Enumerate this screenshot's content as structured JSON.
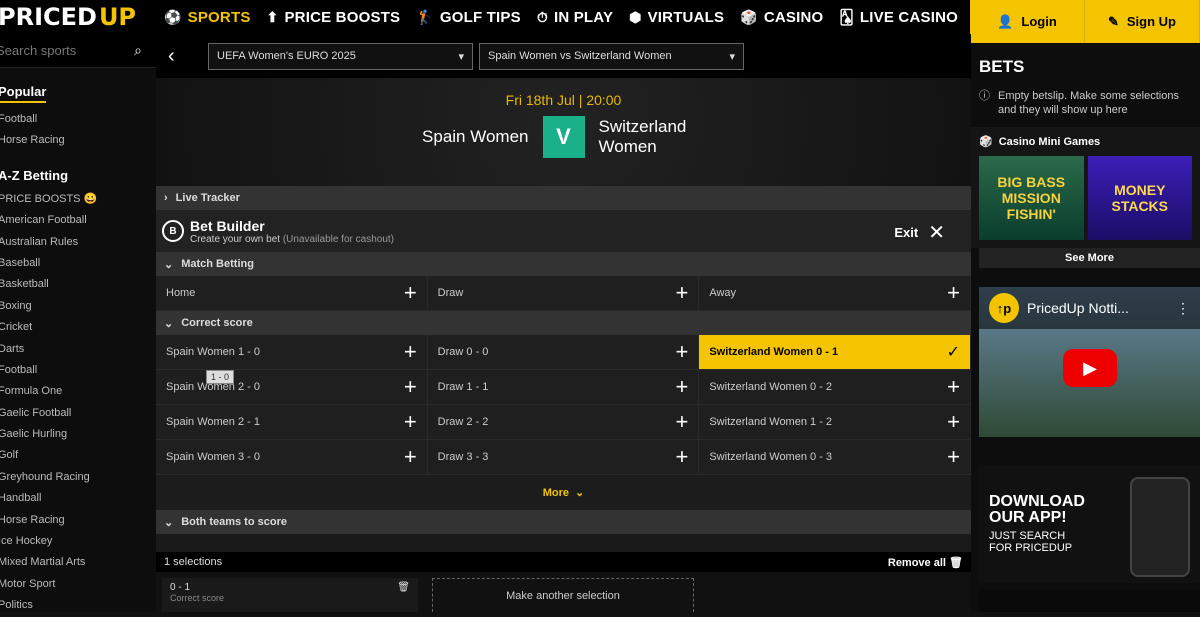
{
  "brand": {
    "logo_main": "PRICED",
    "logo_accent": "UP"
  },
  "nav": [
    {
      "icon": "soccer-ball-icon",
      "glyph": "⚽",
      "label": "SPORTS",
      "active": true
    },
    {
      "icon": "arrow-up-icon",
      "glyph": "⬆",
      "label": "PRICE BOOSTS"
    },
    {
      "icon": "golfer-icon",
      "glyph": "🏌",
      "label": "GOLF TIPS"
    },
    {
      "icon": "stopwatch-icon",
      "glyph": "⏱",
      "label": "IN PLAY"
    },
    {
      "icon": "cube-icon",
      "glyph": "⬢",
      "label": "VIRTUALS"
    },
    {
      "icon": "dice-icon",
      "glyph": "🎲",
      "label": "CASINO"
    },
    {
      "icon": "cards-icon",
      "glyph": "🂡",
      "label": "LIVE CASINO"
    }
  ],
  "auth": {
    "login": "Login",
    "signup": "Sign Up"
  },
  "sidebar": {
    "search_placeholder": "Search sports",
    "popular_title": "Popular",
    "popular": [
      "Football",
      "Horse Racing"
    ],
    "az_title": "A-Z Betting",
    "az": [
      "PRICE BOOSTS 😀",
      "American Football",
      "Australian Rules",
      "Baseball",
      "Basketball",
      "Boxing",
      "Cricket",
      "Darts",
      "Football",
      "Formula One",
      "Gaelic Football",
      "Gaelic Hurling",
      "Golf",
      "Greyhound Racing",
      "Handball",
      "Horse Racing",
      "Ice Hockey",
      "Mixed Martial Arts",
      "Motor Sport",
      "Politics"
    ]
  },
  "selectors": {
    "competition": "UEFA Women's EURO 2025",
    "match": "Spain Women vs Switzerland Women"
  },
  "event": {
    "datetime": "Fri 18th Jul | 20:00",
    "home": "Spain Women",
    "away": "Switzerland Women",
    "vs": "V"
  },
  "live_tracker": "Live Tracker",
  "bet_builder": {
    "title": "Bet Builder",
    "subtitle": "Create your own bet",
    "note": "(Unavailable for cashout)",
    "exit": "Exit"
  },
  "match_betting": {
    "title": "Match Betting",
    "options": [
      "Home",
      "Draw",
      "Away"
    ]
  },
  "correct_score": {
    "title": "Correct score",
    "rows": [
      [
        "Spain Women 1 - 0",
        "Draw 0 - 0",
        "Switzerland Women  0 - 1"
      ],
      [
        "Spain Women 2 - 0",
        "Draw 1 - 1",
        "Switzerland Women  0 - 2"
      ],
      [
        "Spain Women 2 - 1",
        "Draw 2 - 2",
        "Switzerland Women  1 - 2"
      ],
      [
        "Spain Women 3 - 0",
        "Draw 3 - 3",
        "Switzerland Women  0 - 3"
      ]
    ],
    "selected": "Switzerland Women  0 - 1",
    "tooltip": "1 - 0",
    "more": "More"
  },
  "btts_title": "Both teams to score",
  "slip": {
    "count": "1 selections",
    "remove_all": "Remove all",
    "item": "0 - 1",
    "item_sub": "Correct score",
    "another": "Make another selection"
  },
  "right": {
    "bets_title": "BETS",
    "empty": "Empty betslip. Make some selections and they will show up here",
    "casino_title": "Casino Mini Games",
    "games": [
      "BIG BASS MISSION FISHIN'",
      "MONEY STACKS"
    ],
    "see_more": "See More",
    "video_title": "PricedUp Notti...",
    "app_title": "DOWNLOAD OUR APP!",
    "app_sub": "JUST SEARCH FOR PRICEDUP"
  }
}
